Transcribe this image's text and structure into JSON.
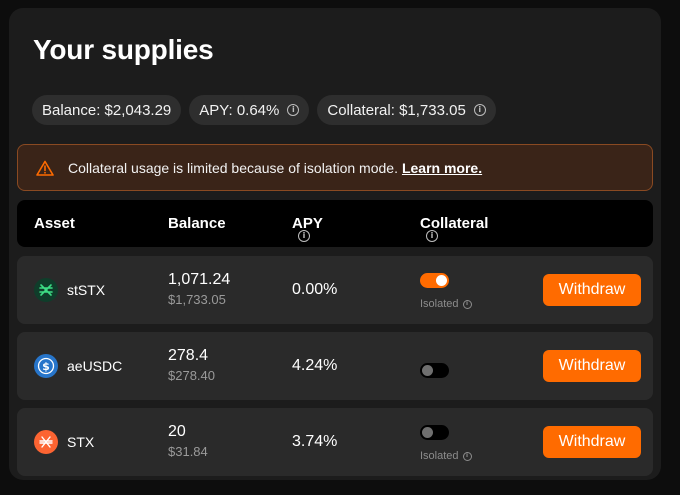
{
  "title": "Your supplies",
  "stats": {
    "balance_label": "Balance:",
    "balance_value": "$2,043.29",
    "apy_label": "APY:",
    "apy_value": "0.64%",
    "collateral_label": "Collateral:",
    "collateral_value": "$1,733.05"
  },
  "warning": {
    "text": "Collateral usage is limited because of isolation mode.",
    "link": "Learn more."
  },
  "table": {
    "headers": {
      "asset": "Asset",
      "balance": "Balance",
      "apy": "APY",
      "collateral": "Collateral"
    },
    "rows": [
      {
        "asset": "stSTX",
        "icon": "ststx-icon",
        "balance": "1,071.24",
        "balance_usd": "$1,733.05",
        "apy": "0.00%",
        "collateral_enabled": true,
        "isolated_label": "Isolated",
        "action": "Withdraw"
      },
      {
        "asset": "aeUSDC",
        "icon": "usdc-icon",
        "balance": "278.4",
        "balance_usd": "$278.40",
        "apy": "4.24%",
        "collateral_enabled": false,
        "isolated_label": "",
        "action": "Withdraw"
      },
      {
        "asset": "STX",
        "icon": "stx-icon",
        "balance": "20",
        "balance_usd": "$31.84",
        "apy": "3.74%",
        "collateral_enabled": false,
        "isolated_label": "Isolated",
        "action": "Withdraw"
      }
    ]
  },
  "colors": {
    "accent": "#ff6b00",
    "panel": "#1c1c1c",
    "row": "#2a2a2a",
    "warning_bg": "#3a2418",
    "warning_border": "#8a4a22"
  }
}
